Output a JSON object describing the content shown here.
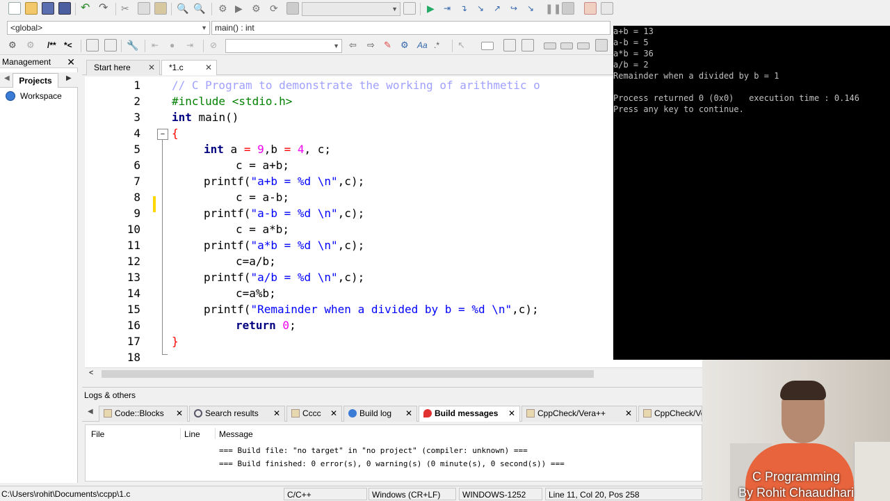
{
  "toolbar": {
    "scope_combo": "<global>",
    "function_combo": "main() : int"
  },
  "management": {
    "title": "Management",
    "close": "✕",
    "tab_projects": "Projects",
    "workspace": "Workspace"
  },
  "editor": {
    "tabs": [
      {
        "label": "Start here",
        "close": "✕"
      },
      {
        "label": "*1.c",
        "close": "✕"
      }
    ],
    "line_numbers": [
      "1",
      "2",
      "3",
      "4",
      "5",
      "6",
      "7",
      "8",
      "9",
      "10",
      "11",
      "12",
      "13",
      "14",
      "15",
      "16",
      "17",
      "18"
    ],
    "code": {
      "l1": "// C Program to demonstrate the working of arithmetic o",
      "l2": "#include <stdio.h>",
      "l3_kw": "int",
      "l3_rest": " main()",
      "l4": "{",
      "l5_kw": "int",
      "l5_a": " a ",
      "l5_eq": "=",
      "l5_n1": " 9",
      "l5_b": ",b ",
      "l5_eq2": "=",
      "l5_n2": " 4",
      "l5_c": ", c;",
      "l6": "c = a+b;",
      "l7_fn": "printf(",
      "l7_str": "\"a+b = %d \\n\"",
      "l7_end": ",c);",
      "l8": "c = a-b;",
      "l9_fn": "printf(",
      "l9_str": "\"a-b = %d \\n\"",
      "l9_end": ",c);",
      "l10": "c = a*b;",
      "l11_fn": "printf(",
      "l11_str": "\"a*b = %d \\n\"",
      "l11_end": ",c);",
      "l12": "c=a/b;",
      "l13_fn": "printf(",
      "l13_str": "\"a/b = %d \\n\"",
      "l13_end": ",c);",
      "l14": "c=a%b;",
      "l15_fn": "printf(",
      "l15_str": "\"Remainder when a divided by b = %d \\n\"",
      "l15_end": ",c);",
      "l16_kw": "return",
      "l16_n": " 0",
      "l16_end": ";",
      "l17": "}"
    }
  },
  "logs": {
    "title": "Logs & others",
    "tabs": [
      {
        "label": "Code::Blocks",
        "close": "✕"
      },
      {
        "label": "Search results",
        "close": "✕"
      },
      {
        "label": "Cccc",
        "close": "✕"
      },
      {
        "label": "Build log",
        "close": "✕"
      },
      {
        "label": "Build messages",
        "close": "✕"
      },
      {
        "label": "CppCheck/Vera++",
        "close": "✕"
      },
      {
        "label": "CppCheck/Ve",
        "close": ""
      }
    ],
    "columns": [
      "File",
      "Line",
      "Message"
    ],
    "messages": [
      "=== Build file: \"no target\" in \"no project\" (compiler: unknown) ===",
      "=== Build finished: 0 error(s), 0 warning(s) (0 minute(s), 0 second(s)) ==="
    ]
  },
  "statusbar": {
    "path": "C:\\Users\\rohit\\Documents\\ccpp\\1.c",
    "language": "C/C++",
    "line_endings": "Windows (CR+LF)",
    "encoding": "WINDOWS-1252",
    "position": "Line 11, Col 20, Pos 258"
  },
  "console": {
    "lines": [
      "a+b = 13",
      "a-b = 5",
      "a*b = 36",
      "a/b = 2",
      "Remainder when a divided by b = 1",
      "",
      "Process returned 0 (0x0)   execution time : 0.146",
      "Press any key to continue."
    ]
  },
  "webcam": {
    "caption_line1": "C Programming",
    "caption_line2": "By Rohit Chaaudhari"
  }
}
